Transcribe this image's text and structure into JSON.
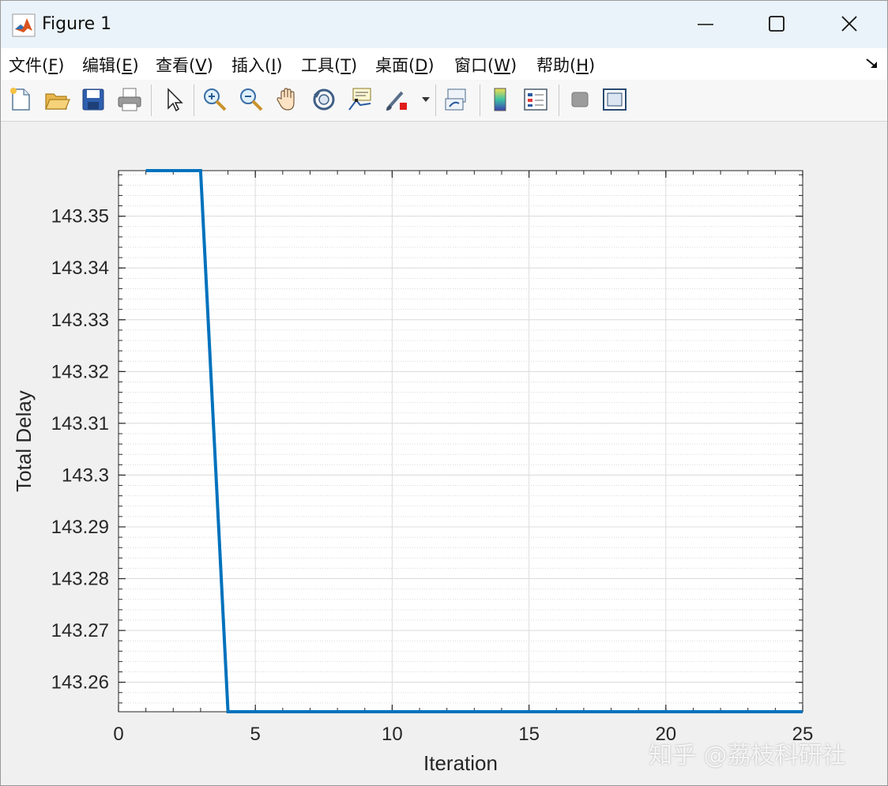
{
  "window": {
    "title": "Figure 1",
    "controls": {
      "minimize": "minimize-icon",
      "maximize": "maximize-icon",
      "close": "close-icon"
    }
  },
  "menu": {
    "items": [
      {
        "label": "文件(",
        "key": "F",
        "suffix": ")"
      },
      {
        "label": "编辑(",
        "key": "E",
        "suffix": ")"
      },
      {
        "label": "查看(",
        "key": "V",
        "suffix": ")"
      },
      {
        "label": "插入(",
        "key": "I",
        "suffix": ")"
      },
      {
        "label": "工具(",
        "key": "T",
        "suffix": ")"
      },
      {
        "label": "桌面(",
        "key": "D",
        "suffix": ")"
      },
      {
        "label": "窗口(",
        "key": "W",
        "suffix": ")"
      },
      {
        "label": "帮助(",
        "key": "H",
        "suffix": ")"
      }
    ]
  },
  "toolbar": {
    "buttons": [
      "new-figure-icon",
      "open-icon",
      "save-icon",
      "print-icon",
      "pointer-icon",
      "zoom-in-icon",
      "zoom-out-icon",
      "pan-icon",
      "rotate-3d-icon",
      "data-cursor-icon",
      "brush-icon",
      "link-plot-icon",
      "colorbar-icon",
      "legend-icon",
      "hide-plot-tools-icon",
      "show-plot-tools-icon"
    ]
  },
  "chart_data": {
    "type": "line",
    "title": "",
    "xlabel": "Iteration",
    "ylabel": "Total Delay",
    "xlim": [
      0,
      25
    ],
    "ylim": [
      143.2543,
      143.3588
    ],
    "xticks": [
      0,
      5,
      10,
      15,
      20,
      25
    ],
    "yticks": [
      143.26,
      143.27,
      143.28,
      143.29,
      143.3,
      143.31,
      143.32,
      143.33,
      143.34,
      143.35
    ],
    "ytick_labels": [
      "143.26",
      "143.27",
      "143.28",
      "143.29",
      "143.3",
      "143.31",
      "143.32",
      "143.33",
      "143.34",
      "143.35"
    ],
    "grid": true,
    "minor_grid": true,
    "series": [
      {
        "color": "#0072bd",
        "x": [
          1,
          2,
          3,
          4,
          5,
          6,
          7,
          8,
          9,
          10,
          11,
          12,
          13,
          14,
          15,
          16,
          17,
          18,
          19,
          20,
          21,
          22,
          23,
          24,
          25
        ],
        "y": [
          143.3588,
          143.3588,
          143.3588,
          143.2543,
          143.2543,
          143.2543,
          143.2543,
          143.2543,
          143.2543,
          143.2543,
          143.2543,
          143.2543,
          143.2543,
          143.2543,
          143.2543,
          143.2543,
          143.2543,
          143.2543,
          143.2543,
          143.2543,
          143.2543,
          143.2543,
          143.2543,
          143.2543,
          143.2543
        ]
      }
    ]
  },
  "watermark": "知乎 @荔枝科研社"
}
